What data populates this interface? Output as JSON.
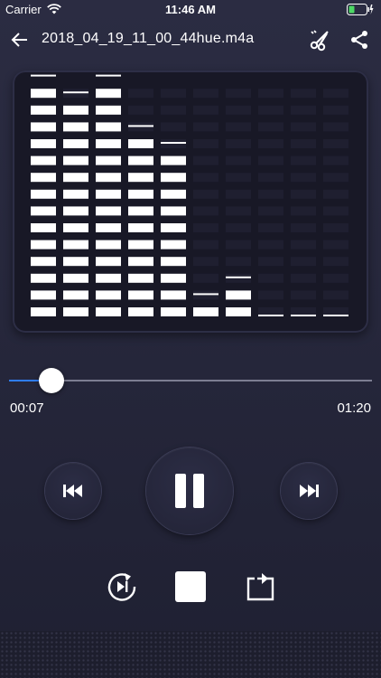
{
  "status_bar": {
    "carrier": "Carrier",
    "time": "11:46 AM"
  },
  "nav": {
    "title": "2018_04_19_11_00_44hue.m4a",
    "icons": {
      "back": "arrow-left-icon",
      "cut": "scissors-icon",
      "share": "share-icon"
    }
  },
  "visualizer": {
    "columns": 10,
    "max_segments": 14,
    "levels": [
      14,
      13,
      14,
      11,
      10,
      1,
      2,
      0,
      0,
      0
    ],
    "peak_caps": [
      14,
      13,
      14,
      11,
      10,
      1,
      2,
      0,
      0,
      0
    ]
  },
  "player": {
    "current_time": "00:07",
    "total_time": "01:20",
    "progress": 0.0875
  },
  "controls": {
    "icons": [
      "skip-previous-icon",
      "pause-icon",
      "skip-next-icon",
      "replay-icon",
      "stop-icon",
      "loop-icon"
    ]
  },
  "colors": {
    "background": "#272839",
    "accent": "#2f7df6",
    "bar": "#ffffff"
  }
}
